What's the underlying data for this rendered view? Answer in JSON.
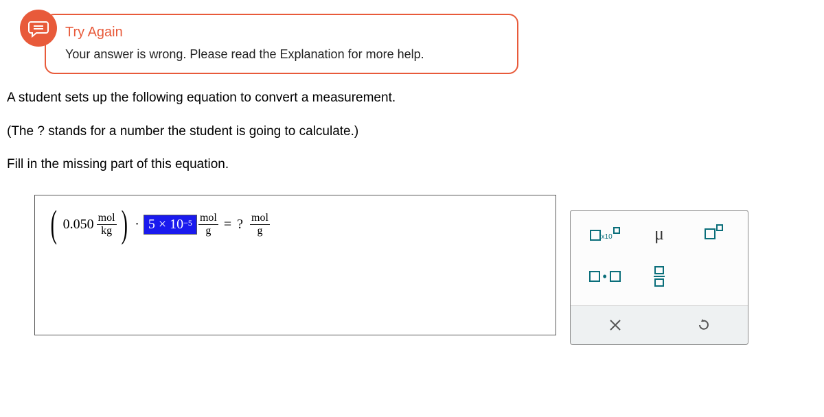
{
  "feedback": {
    "title": "Try Again",
    "body": "Your answer is wrong. Please read the Explanation for more help."
  },
  "problem": {
    "line1": "A student sets up the following equation to convert a measurement.",
    "line2": "(The ? stands for a number the student is going to calculate.)",
    "line3": "Fill in the missing part of this equation."
  },
  "equation": {
    "coef": "0.050",
    "unit1_top": "mol",
    "unit1_bot": "kg",
    "wrong_base": "5 × 10",
    "wrong_exp": "−5",
    "unit2_top": "mol",
    "unit2_bot": "g",
    "equals": "=",
    "rhs": "?",
    "unit3_top": "mol",
    "unit3_bot": "g"
  },
  "toolbox": {
    "sci_label": "x10",
    "mu": "μ",
    "times": "×",
    "undo": "↺"
  }
}
